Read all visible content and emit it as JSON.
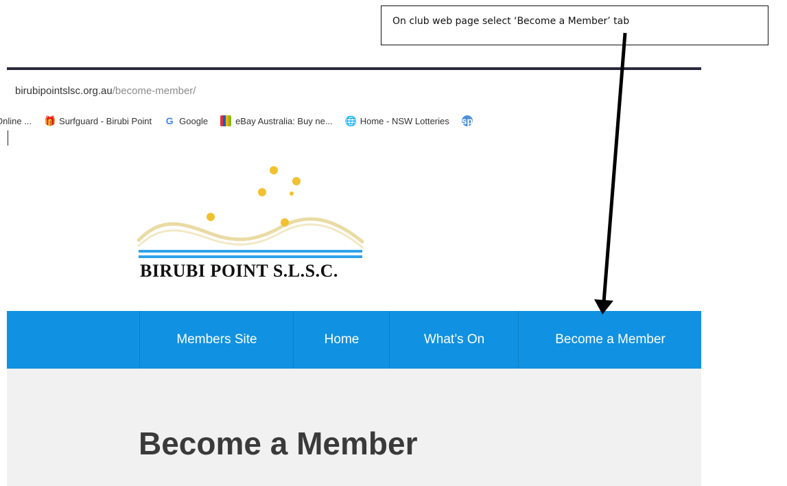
{
  "callout": {
    "text": "On club  web page select ‘Become  a Member’ tab"
  },
  "browser": {
    "url_domain": "birubipointslsc.org.au",
    "url_path": "/become-member/",
    "bookmarks": [
      {
        "icon": "gift-icon",
        "label": "Online ..."
      },
      {
        "icon": "gift-icon",
        "label": "Surfguard - Birubi Point"
      },
      {
        "icon": "google-icon",
        "label": "Google"
      },
      {
        "icon": "ebay-icon",
        "label": "eBay Australia: Buy ne..."
      },
      {
        "icon": "globe-icon",
        "label": "Home - NSW Lotteries"
      },
      {
        "icon": "extension-icon",
        "label": ""
      }
    ]
  },
  "site": {
    "logo_text": "BIRUBI POINT S.L.S.C.",
    "nav": [
      {
        "label": "Members Site"
      },
      {
        "label": "Home"
      },
      {
        "label": "What’s On"
      },
      {
        "label": "Become a Member"
      }
    ],
    "page_title": "Become a Member"
  },
  "colors": {
    "nav_bg": "#1191e1",
    "content_bg": "#f1f1f1",
    "star": "#f2c12e",
    "wave": "#eadba4",
    "stripe": "#2fa3e8"
  }
}
